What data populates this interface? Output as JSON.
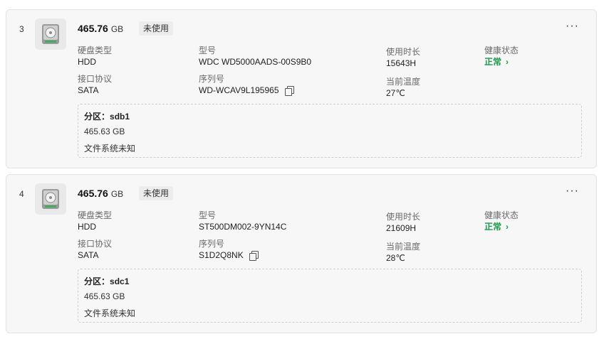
{
  "disks": [
    {
      "index": "3",
      "capacity_value": "465.76",
      "capacity_unit": "GB",
      "usage_status": "未使用",
      "more_label": "···",
      "fields": {
        "type_label": "硬盘类型",
        "type_value": "HDD",
        "interface_label": "接口协议",
        "interface_value": "SATA",
        "model_label": "型号",
        "model_value": "WDC WD5000AADS-00S9B0",
        "serial_label": "序列号",
        "serial_value": "WD-WCAV9L195965",
        "hours_label": "使用时长",
        "hours_value": "15643H",
        "temp_label": "当前温度",
        "temp_value": "27℃",
        "health_label": "健康状态",
        "health_value": "正常"
      },
      "partition": {
        "title_label": "分区：",
        "name": "sdb1",
        "size": "465.63 GB",
        "filesystem": "文件系统未知"
      }
    },
    {
      "index": "4",
      "capacity_value": "465.76",
      "capacity_unit": "GB",
      "usage_status": "未使用",
      "more_label": "···",
      "fields": {
        "type_label": "硬盘类型",
        "type_value": "HDD",
        "interface_label": "接口协议",
        "interface_value": "SATA",
        "model_label": "型号",
        "model_value": "ST500DM002-9YN14C",
        "serial_label": "序列号",
        "serial_value": "S1D2Q8NK",
        "hours_label": "使用时长",
        "hours_value": "21609H",
        "temp_label": "当前温度",
        "temp_value": "28℃",
        "health_label": "健康状态",
        "health_value": "正常"
      },
      "partition": {
        "title_label": "分区：",
        "name": "sdc1",
        "size": "465.63 GB",
        "filesystem": "文件系统未知"
      }
    }
  ],
  "icons": {
    "disk": "hard-drive-icon",
    "copy": "copy-icon",
    "more": "more-options-icon",
    "chevron": "chevron-right-icon"
  },
  "colors": {
    "healthy": "#1a9a4a",
    "card_bg": "#f7f7f7",
    "card_border": "#e2e2e2"
  }
}
